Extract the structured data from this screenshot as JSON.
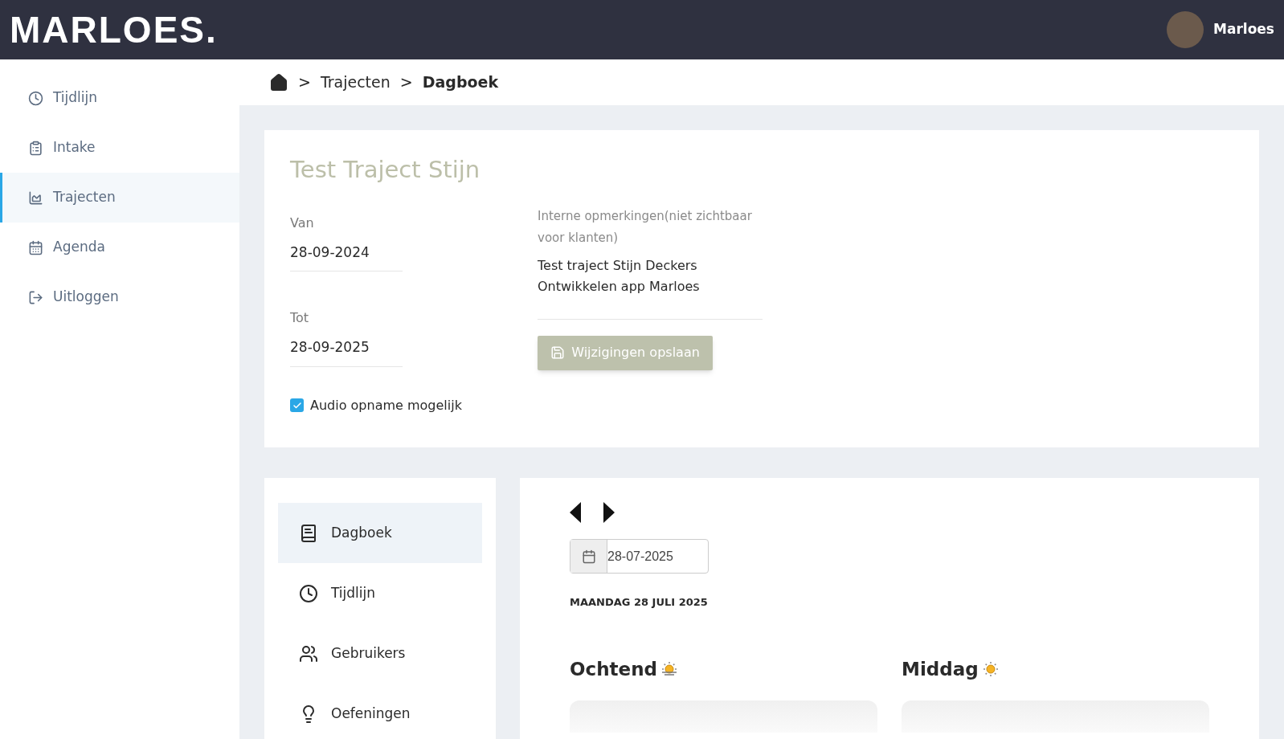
{
  "header": {
    "logo": "MARLOES.",
    "user": "Marloes"
  },
  "sidebar": {
    "items": [
      {
        "label": "Tijdlijn",
        "selected": false
      },
      {
        "label": "Intake",
        "selected": false
      },
      {
        "label": "Trajecten",
        "selected": true
      },
      {
        "label": "Agenda",
        "selected": false
      },
      {
        "label": "Uitloggen",
        "selected": false
      }
    ]
  },
  "breadcrumb": [
    {
      "separator": ">",
      "label": "Trajecten",
      "current": false
    },
    {
      "separator": ">",
      "label": "Dagboek",
      "current": true
    }
  ],
  "traject": {
    "title": "Test Traject Stijn",
    "van": {
      "label": "Van",
      "value": "28-09-2024"
    },
    "tot": {
      "label": "Tot",
      "value": "28-09-2025"
    },
    "audio": {
      "label": "Audio opname mogelijk",
      "checked": true
    },
    "remarks": {
      "label": "Interne opmerkingen(niet zichtbaar voor klanten)",
      "value": "Test traject Stijn Deckers\nOntwikkelen app Marloes"
    },
    "save_button": "Wijzigingen opslaan"
  },
  "menu": {
    "items": [
      {
        "label": "Dagboek",
        "selected": true
      },
      {
        "label": "Tijdlijn",
        "selected": false
      },
      {
        "label": "Gebruikers",
        "selected": false
      },
      {
        "label": "Oefeningen",
        "selected": false
      }
    ]
  },
  "diary": {
    "date": "28-07-2025",
    "date_heading": "MAANDAG 28 JULI 2025",
    "parts": [
      {
        "title": "Ochtend",
        "kind": "sunrise"
      },
      {
        "title": "Middag",
        "kind": "sun"
      }
    ]
  }
}
